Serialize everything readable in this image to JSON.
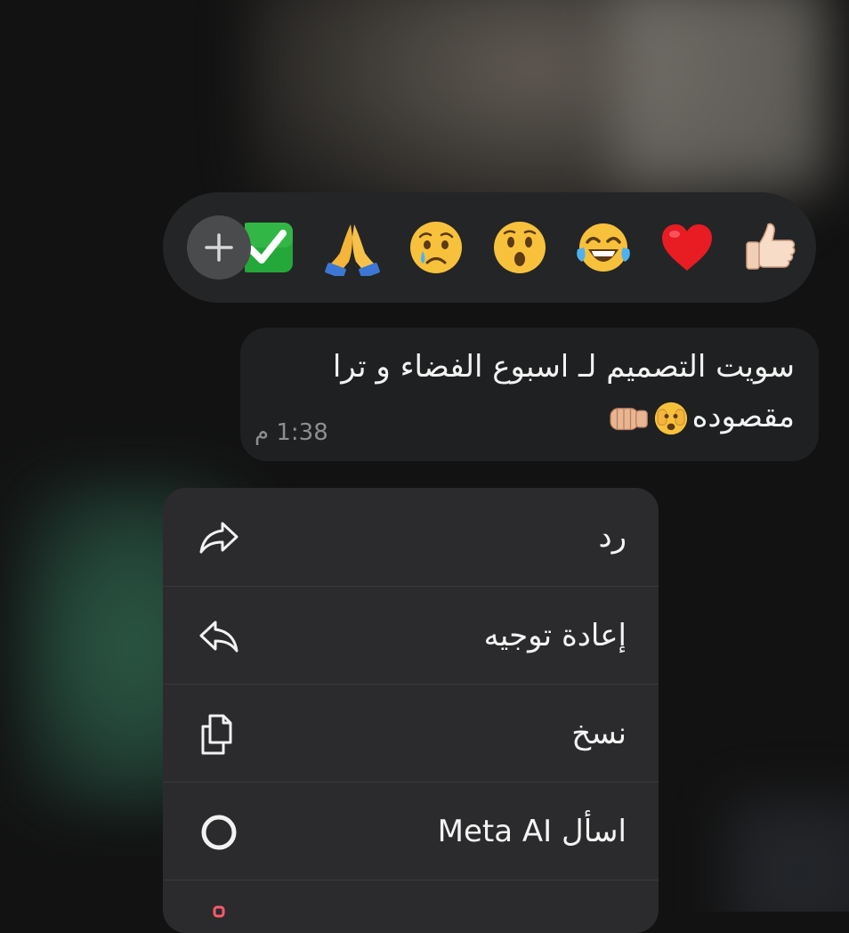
{
  "reactions": {
    "add_button": "add-reaction",
    "emojis": [
      "✅",
      "🙏",
      "😢",
      "😮",
      "😂",
      "❤️",
      "👍🏻"
    ]
  },
  "message": {
    "line1": "سويت التصميم لـ اسبوع الفضاء و ترا",
    "line2_text": "مقصوده",
    "line2_emojis": [
      "🫣",
      "👊🏼"
    ],
    "time": "1:38 م"
  },
  "menu": {
    "items": [
      {
        "label": "رد",
        "icon": "reply-arrow-icon"
      },
      {
        "label": "إعادة توجيه",
        "icon": "forward-arrow-icon"
      },
      {
        "label": "نسخ",
        "icon": "copy-icon"
      },
      {
        "label": "اسأل Meta AI",
        "icon": "meta-ai-ring-icon"
      }
    ]
  },
  "colors": {
    "reaction_bar": "#242526",
    "bubble": "#1f2021",
    "menu": "#2b2b2d",
    "text": "#f2f2f2",
    "muted": "#8d8e90"
  }
}
